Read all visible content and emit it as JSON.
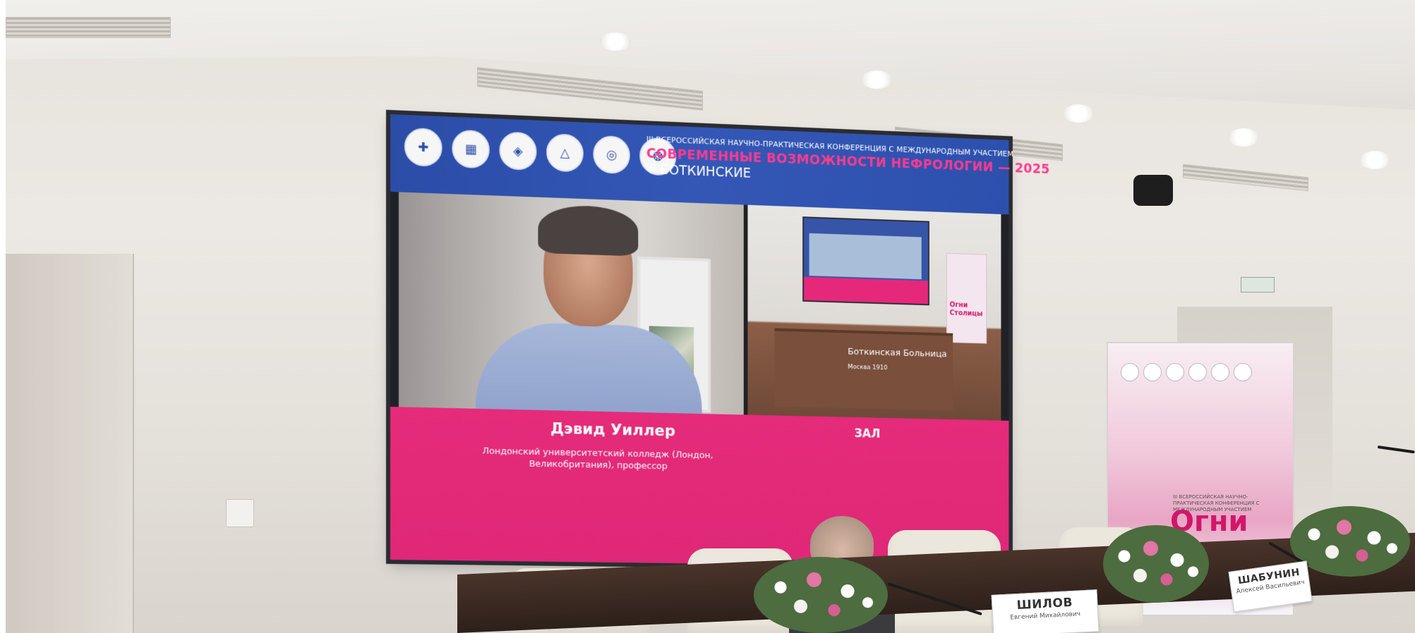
{
  "screen": {
    "header": {
      "conference_line": "III ВСЕРОССИЙСКАЯ НАУЧНО-ПРАКТИЧЕСКАЯ КОНФЕРЕНЦИЯ С МЕЖДУНАРОДНЫМ УЧАСТИЕМ",
      "title": "СОВРЕМЕННЫЕ ВОЗМОЖНОСТИ НЕФРОЛОГИИ — 2025",
      "brand": "БОТКИНСКИЕ",
      "logos": [
        "hospital-cross-logo",
        "fmabmo-logo",
        "bird-emblem-logo",
        "triangle-logo",
        "ring-logo",
        "globe-emblem-logo"
      ]
    },
    "speaker": {
      "name": "Дэвид Уиллер",
      "affiliation": "Лондонский университетский колледж (Лондон, Великобритания), профессор"
    },
    "hall": {
      "label": "ЗАЛ",
      "podium_text": "Боткинская Больница",
      "podium_subtext": "Москва 1910",
      "mini_banner": "Огни Столицы"
    }
  },
  "banner": {
    "small_text": "III ВСЕРОССИЙСКАЯ НАУЧНО-ПРАКТИЧЕСКАЯ КОНФЕРЕНЦИЯ С МЕЖДУНАРОДНЫМ УЧАСТИЕМ",
    "title": "Огни Столицы"
  },
  "nameplates": [
    {
      "surname": "ШИЛОВ",
      "first_names": "Евгений Михайлович"
    },
    {
      "surname": "ШАБУНИН",
      "first_names": "Алексей Васильевич"
    }
  ]
}
